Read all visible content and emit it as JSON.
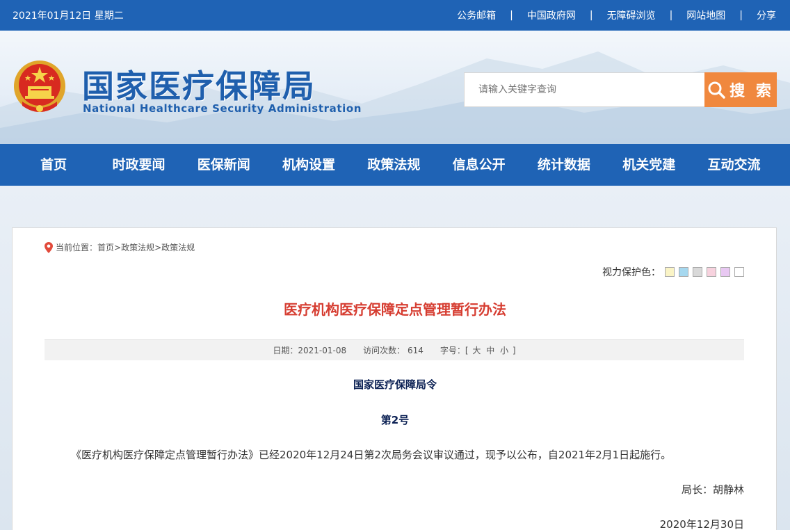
{
  "topbar": {
    "date": "2021年01月12日 星期二",
    "links": [
      "公务邮箱",
      "中国政府网",
      "无障碍浏览",
      "网站地图",
      "分享"
    ],
    "separator": "|"
  },
  "header": {
    "title": "国家医疗保障局",
    "subtitle": "National Healthcare Security Administration",
    "search_placeholder": "请输入关键字查询",
    "search_label": "搜 索"
  },
  "nav": [
    "首页",
    "时政要闻",
    "医保新闻",
    "机构设置",
    "政策法规",
    "信息公开",
    "统计数据",
    "机关党建",
    "互动交流"
  ],
  "breadcrumb": {
    "prefix": "当前位置：",
    "items": [
      "首页",
      "政策法规",
      "政策法规"
    ],
    "sep": ">"
  },
  "vision": {
    "label": "视力保护色：",
    "swatches": [
      "#faf4c6",
      "#a6d8ef",
      "#d9d9d9",
      "#f7d2de",
      "#e8c8f2",
      "#ffffff"
    ]
  },
  "article": {
    "title": "医疗机构医疗保障定点管理暂行办法",
    "date_label": "日期：2021-01-08",
    "visits_label": "访问次数：  614",
    "font_label": "字号：[",
    "font_large": "大",
    "font_mid": "中",
    "font_small": "小",
    "font_end": "]",
    "order": "国家医疗保障局令",
    "number": "第2号",
    "body": "《医疗机构医疗保障定点管理暂行办法》已经2020年12月24日第2次局务会议审议通过，现予以公布，自2021年2月1日起施行。",
    "signer": "局长：胡静林",
    "sign_date": "2020年12月30日"
  },
  "colors": {
    "brand_blue": "#1f63b5",
    "search_orange": "#f0883e",
    "title_red": "#d63d31"
  }
}
